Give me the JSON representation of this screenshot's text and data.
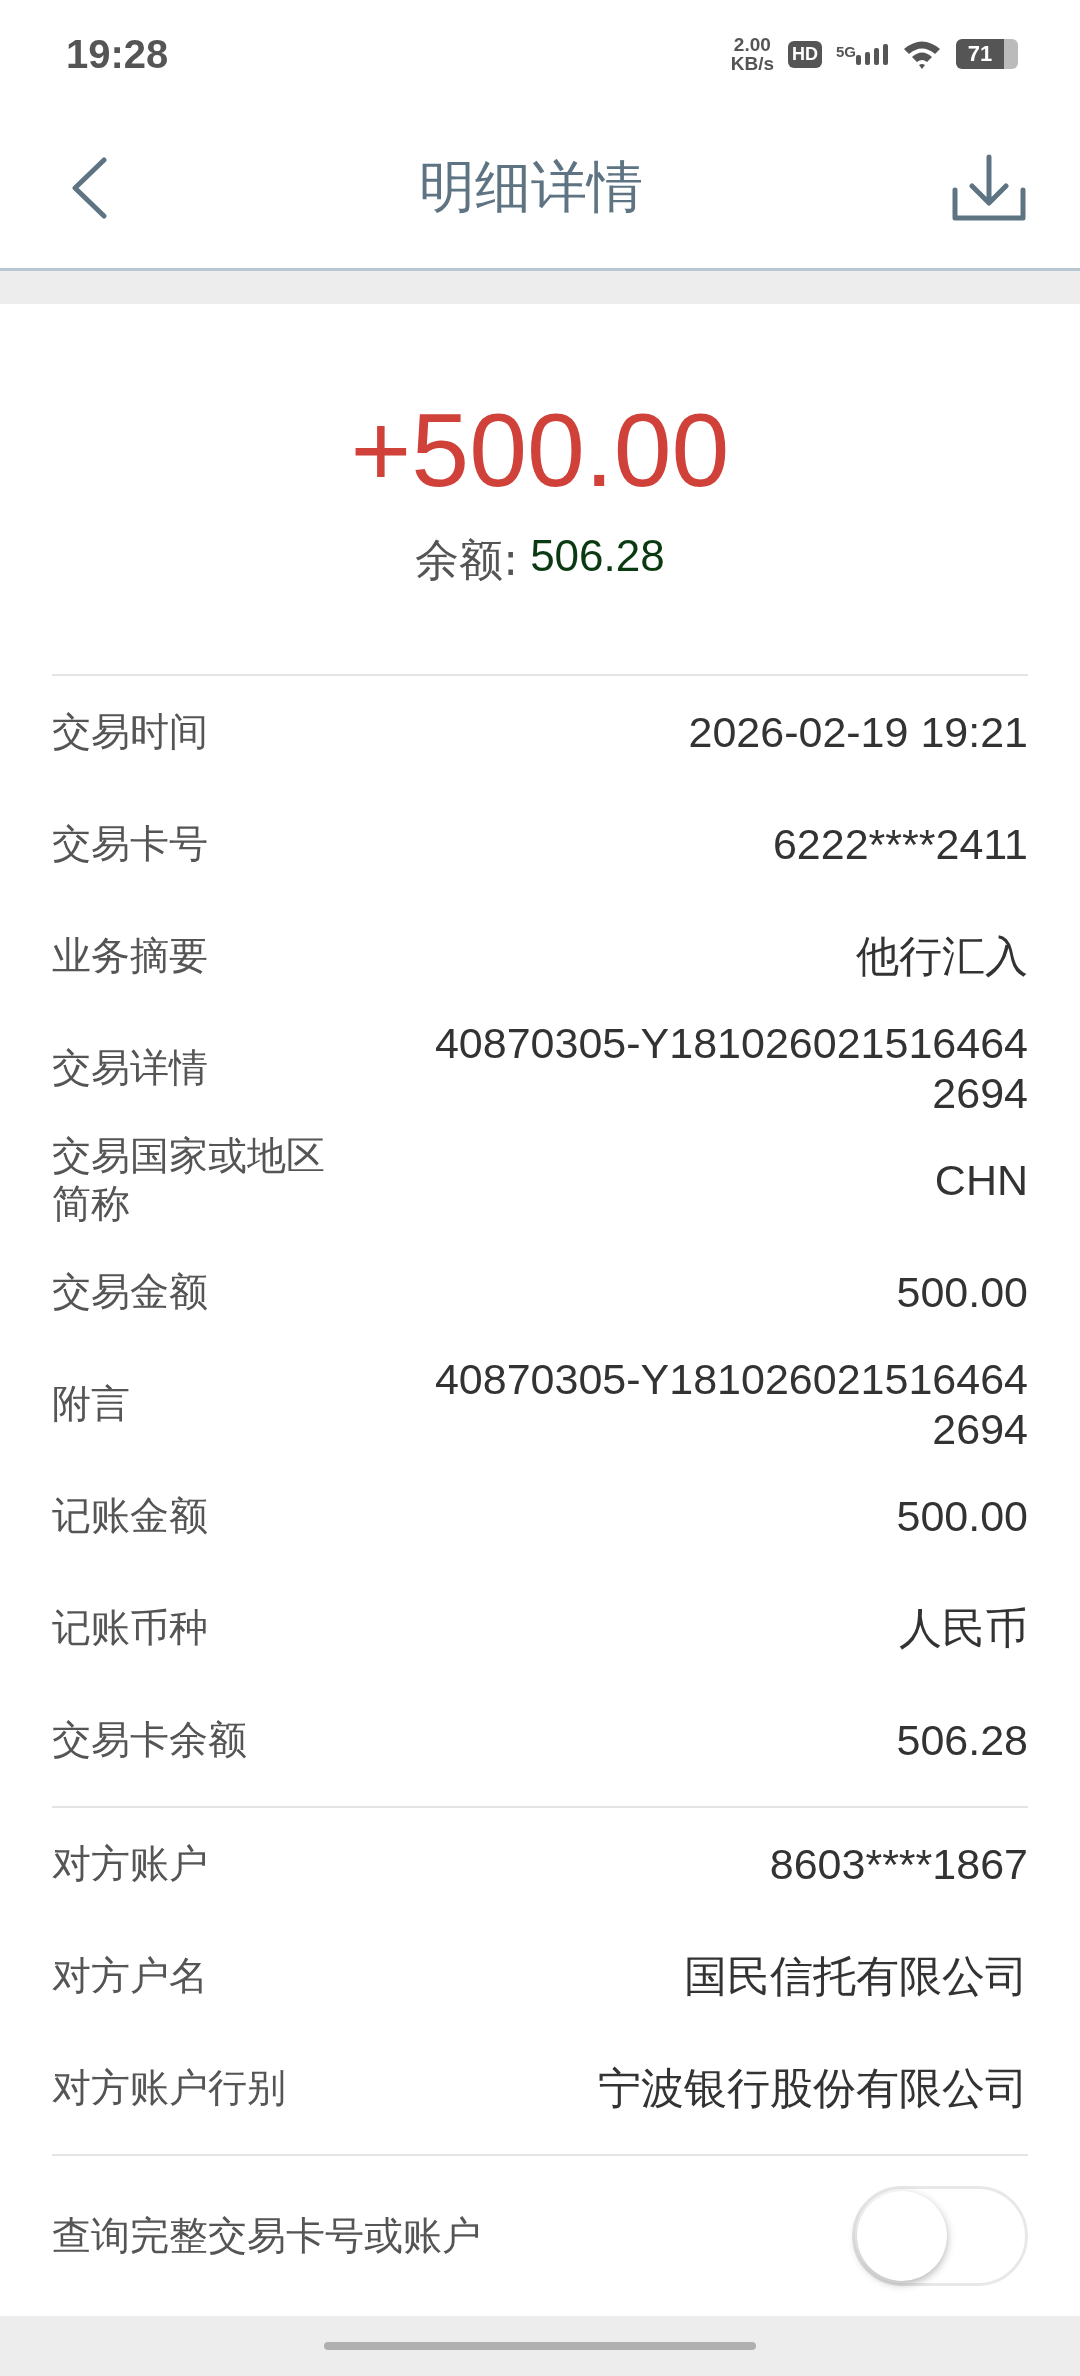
{
  "status_bar": {
    "time": "19:28",
    "speed_value": "2.00",
    "speed_unit": "KB/s",
    "hd_badge": "HD",
    "network": "5G",
    "battery": "71"
  },
  "header": {
    "title": "明细详情"
  },
  "summary": {
    "amount": "+500.00",
    "balance_label": "余额:",
    "balance_value": "506.28"
  },
  "sections": [
    {
      "rows": [
        {
          "label": "交易时间",
          "value": "2026-02-19 19:21"
        },
        {
          "label": "交易卡号",
          "value": "6222****2411"
        },
        {
          "label": "业务摘要",
          "value": "他行汇入"
        },
        {
          "label": "交易详情",
          "value": "40870305-Y181026021516464 2694"
        },
        {
          "label": "交易国家或地区简称",
          "value": "CHN"
        },
        {
          "label": "交易金额",
          "value": "500.00"
        },
        {
          "label": "附言",
          "value": "40870305-Y181026021516464 2694"
        },
        {
          "label": "记账金额",
          "value": "500.00"
        },
        {
          "label": "记账币种",
          "value": "人民币"
        },
        {
          "label": "交易卡余额",
          "value": "506.28"
        }
      ]
    },
    {
      "rows": [
        {
          "label": "对方账户",
          "value": "8603****1867"
        },
        {
          "label": "对方户名",
          "value": "国民信托有限公司"
        },
        {
          "label": "对方账户行别",
          "value": "宁波银行股份有限公司"
        }
      ]
    }
  ],
  "toggle": {
    "label": "查询完整交易卡号或账户",
    "checked": false
  }
}
